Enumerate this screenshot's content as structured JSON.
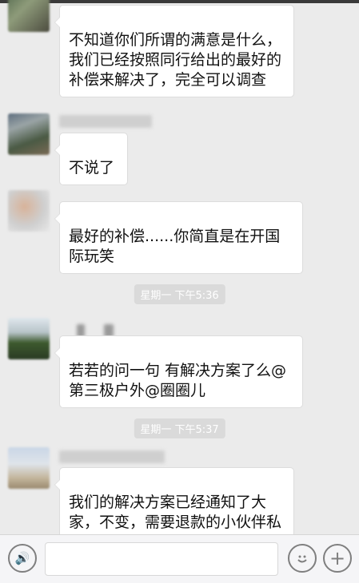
{
  "chat": {
    "messages": [
      {
        "text": "不知道你们所谓的满意是什么，我们已经按照同行给出的最好的补偿来解决了，完全可以调查"
      },
      {
        "text": "不说了"
      },
      {
        "text": "最好的补偿......你简直是在开国际玩笑"
      },
      {
        "text": "若若的问一句  有解决方案了么@第三极户外@圈圈儿"
      },
      {
        "text": "我们的解决方案已经通知了大家，不变，需要退款的小伙伴私下联系我"
      }
    ],
    "timestamps": [
      "星期一 下午5:36",
      "星期一 下午5:37"
    ]
  },
  "input_bar": {
    "voice_icon": "voice-icon",
    "emoji_icon": "emoji-icon",
    "plus_icon": "plus-icon",
    "voice_glyph": "🔊",
    "plus_glyph": "+"
  },
  "colors": {
    "background": "#ebebeb",
    "bubble": "#ffffff",
    "timestamp_bg": "#dadada"
  }
}
